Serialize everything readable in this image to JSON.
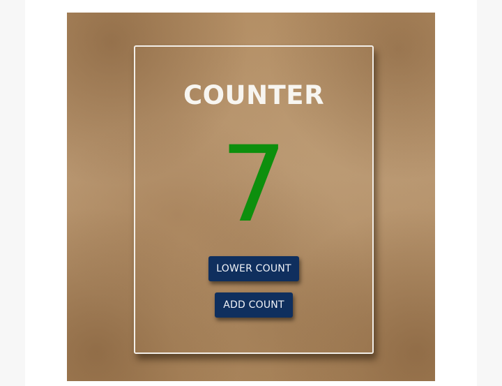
{
  "counter": {
    "title": "COUNTER",
    "value": "7",
    "lower_button_label": "LOWER COUNT",
    "add_button_label": "ADD COUNT"
  },
  "colors": {
    "count_value": "#0d8f0d",
    "button_background": "#0f2f5e",
    "title_text": "#f7f5f0",
    "paper_background": "#b39068"
  }
}
